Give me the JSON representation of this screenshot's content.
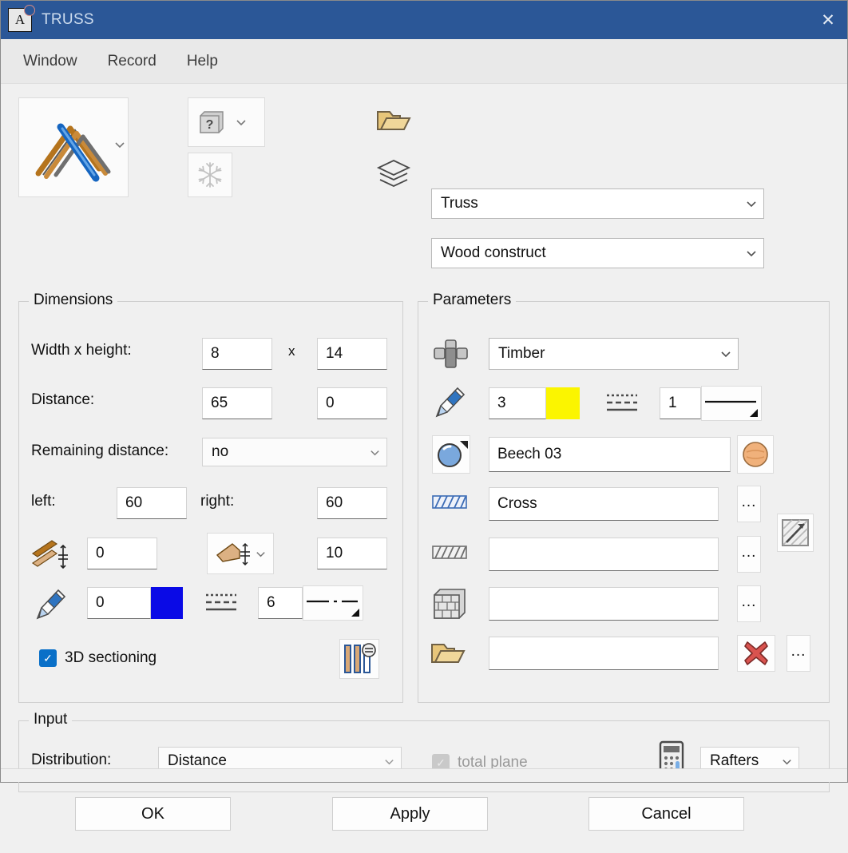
{
  "window": {
    "title": "TRUSS",
    "app_icon": "app-a-icon",
    "close_label": "✕"
  },
  "menubar": {
    "items": [
      {
        "label": "Window"
      },
      {
        "label": "Record"
      },
      {
        "label": "Help"
      }
    ]
  },
  "toolbar": {
    "preview_icon": "truss-preview-icon",
    "preview_caret": "chevron-down-icon",
    "help_icon": "help-cube-icon",
    "help_caret": "chevron-down-icon",
    "freeze_icon": "snowflake-icon",
    "folder_icon": "folder-open-icon",
    "layers_icon": "layers-icon",
    "truss_value": "Truss",
    "layer_value": "Wood construct"
  },
  "dimensions": {
    "legend": "Dimensions",
    "width_height_label": "Width x height:",
    "width_value": "8",
    "times_label": "x",
    "height_value": "14",
    "distance_label": "Distance:",
    "distance_value": "65",
    "distance_value2": "0",
    "remaining_label": "Remaining distance:",
    "remaining_value": "no",
    "left_label": "left:",
    "left_value": "60",
    "right_label": "right:",
    "right_value": "60",
    "beam_icon": "beam-stack-height-icon",
    "beam_value": "0",
    "cut_icon": "beam-cut-height-icon",
    "cut_caret": "chevron-down-icon",
    "cut_value": "10",
    "pen_icon": "pencil-icon",
    "pen_value": "0",
    "pen_color": "#0a0ae6",
    "linetype_icon": "line-types-icon",
    "line_value": "6",
    "line_preview": "dash-dot-line-preview",
    "sectioning_label": "3D sectioning",
    "sectioning_checked": true,
    "sectioning_icon": "section-columns-icon"
  },
  "parameters": {
    "legend": "Parameters",
    "material_icon": "cross-section-icon",
    "material_value": "Timber",
    "pen_icon": "pencil-icon",
    "pen_value": "3",
    "pen_color": "#fbf500",
    "linetype_icon": "line-types-icon",
    "line_value": "1",
    "line_preview": "solid-line-preview",
    "surface_icon": "sphere-surface-icon",
    "surface_value": "Beech 03",
    "surface_swatch": "wood-sphere-swatch",
    "hatch1_icon": "hatch-blue-icon",
    "hatch1_value": "Cross",
    "hatch1_more": "...",
    "hatch2_icon": "hatch-gray-icon",
    "hatch2_value": "",
    "hatch2_more": "...",
    "hatch_off_icon": "hatch-disabled-icon",
    "pattern_icon": "brick-wall-icon",
    "pattern_value": "",
    "pattern_more": "...",
    "folder_icon": "folder-open-icon",
    "folder_value": "",
    "folder_delete_icon": "red-x-delete-icon",
    "folder_more": "..."
  },
  "input": {
    "legend": "Input",
    "distribution_label": "Distribution:",
    "distribution_value": "Distance",
    "total_plane_label": "total plane",
    "total_plane_checked": true,
    "calculator_icon": "calculator-icon",
    "rafters_value": "Rafters"
  },
  "buttons": {
    "ok": "OK",
    "apply": "Apply",
    "cancel": "Cancel"
  },
  "colors": {
    "titlebar": "#2b5797",
    "accent_checkbox": "#0a70c8",
    "pen_blue": "#0a0ae6",
    "pen_yellow": "#fbf500",
    "delete_red": "#d9534f"
  }
}
